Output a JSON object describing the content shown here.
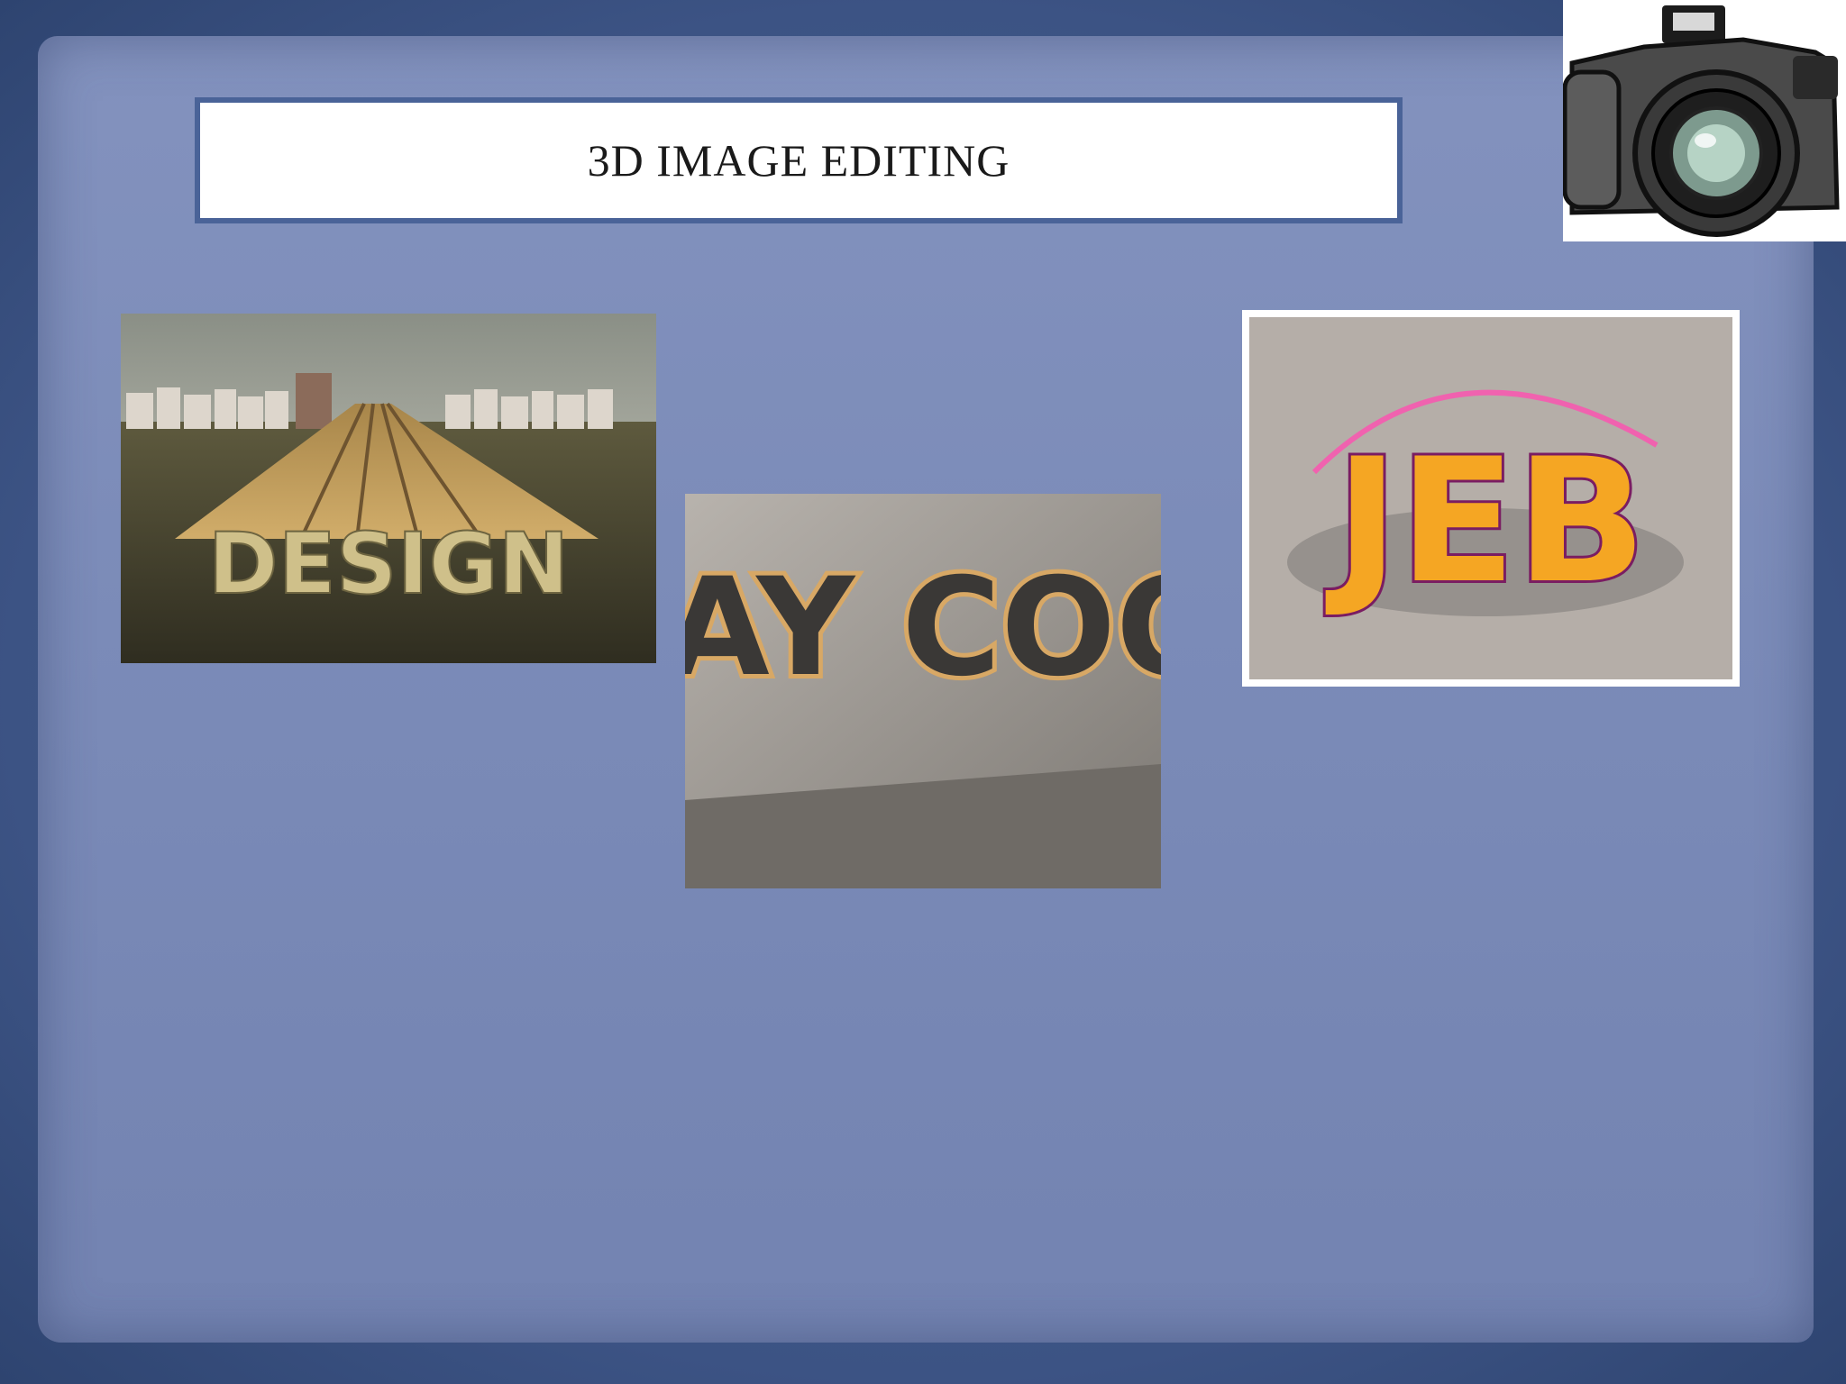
{
  "slide": {
    "title": "3D IMAGE EDITING"
  },
  "images": {
    "design_lettering": "DESIGN",
    "stay_lettering": "STAY COOL",
    "jeb_lettering": "JEB"
  },
  "colors": {
    "frame": "#3f5683",
    "paper": "#7b8bb8",
    "title_border": "#4a6398"
  }
}
